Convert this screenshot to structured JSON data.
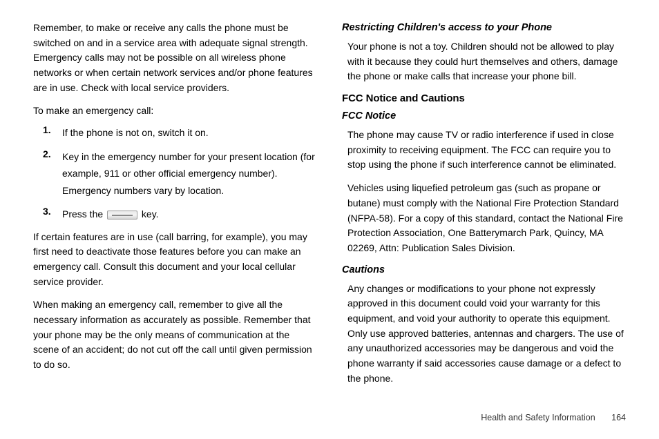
{
  "left": {
    "p1": "Remember, to make or receive any calls the phone must be switched on and in a service area with adequate signal strength. Emergency calls may not be possible on all wireless phone networks or when certain network services and/or phone features are in use. Check with local service providers.",
    "p2": "To make an emergency call:",
    "steps": [
      {
        "n": "1.",
        "t": "If the phone is not on, switch it on."
      },
      {
        "n": "2.",
        "t": "Key in the emergency number for your present location (for example, 911 or other official emergency number). Emergency numbers vary by location."
      },
      {
        "n": "3.",
        "pre": "Press the ",
        "post": " key."
      }
    ],
    "p3": "If certain features are in use (call barring, for example), you may first need to deactivate those features before you can make an emergency call. Consult this document and your local cellular service provider.",
    "p4": "When making an emergency call, remember to give all the necessary information as accurately as possible. Remember that your phone may be the only means of communication at the scene of an accident; do not cut off the call until given permission to do so."
  },
  "right": {
    "h1": "Restricting Children's access to your Phone",
    "p1": "Your phone is not a toy. Children should not be allowed to play with it because they could hurt themselves and others, damage the phone or make calls that increase your phone bill.",
    "h2": "FCC Notice and Cautions",
    "h3": "FCC Notice",
    "p2": "The phone may cause TV or radio interference if used in close proximity to receiving equipment. The FCC can require you to stop using the phone if such interference cannot be eliminated.",
    "p3": "Vehicles using liquefied petroleum gas (such as propane or butane) must comply with the National Fire Protection Standard (NFPA-58). For a copy of this standard, contact the National Fire Protection Association, One Batterymarch Park, Quincy, MA 02269, Attn: Publication Sales Division.",
    "h4": "Cautions",
    "p4": "Any changes or modifications to your phone not expressly approved in this document could void your warranty for this equipment, and void your authority to operate this equipment. Only use approved batteries, antennas and chargers. The use of any unauthorized accessories may be dangerous and void the phone warranty if said accessories cause damage or a defect to the phone."
  },
  "footer": {
    "section": "Health and Safety Information",
    "page": "164"
  }
}
